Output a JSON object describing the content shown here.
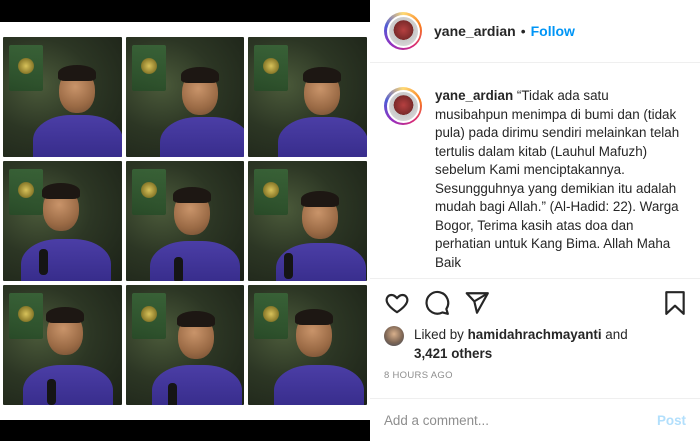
{
  "post": {
    "username": "yane_ardian",
    "separator": "•",
    "follow_label": "Follow",
    "caption_username": "yane_ardian",
    "caption_text": "“Tidak ada satu musibahpun menimpa di bumi dan (tidak pula) pada dirimu sendiri melainkan telah tertulis dalam kitab (Lauhul Mafuzh) sebelum Kami menciptakannya. Sesungguhnya yang demikian itu adalah mudah bagi Allah.” (Al-Hadid: 22). Warga Bogor, Terima kasih atas doa dan perhatian untuk Kang Bima. Allah Maha Baik",
    "likes_prefix": "Liked by",
    "liked_by_user": "hamidahrachmayanti",
    "likes_and": "and",
    "likes_others": "3,421 others",
    "timestamp": "8 HOURS AGO",
    "comment_placeholder": "Add a comment...",
    "post_label": "Post"
  },
  "icons": {
    "like": "heart-icon",
    "comment": "comment-icon",
    "share": "share-icon",
    "save": "bookmark-icon"
  },
  "colors": {
    "link_blue": "#0095f6",
    "post_disabled": "#b2dffc",
    "muted": "#8e8e8e",
    "text": "#262626",
    "shirt_purple": "#3b2f93"
  }
}
